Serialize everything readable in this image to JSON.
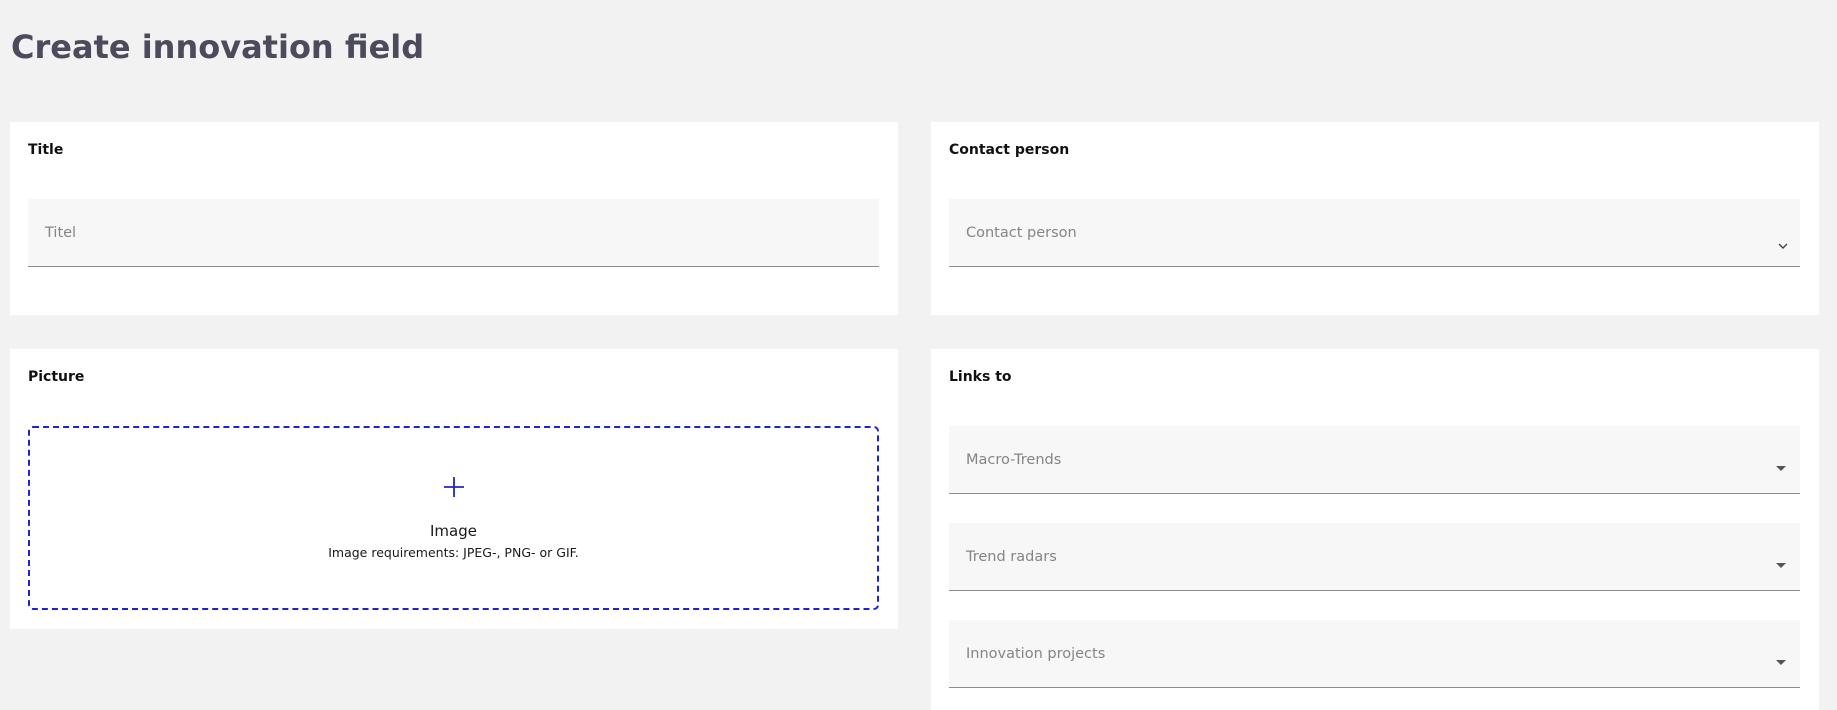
{
  "page": {
    "title": "Create innovation field"
  },
  "title_card": {
    "label": "Title",
    "input_placeholder": "Titel"
  },
  "contact_card": {
    "label": "Contact person",
    "select_placeholder": "Contact person",
    "icon": "chevron-down-icon"
  },
  "picture_card": {
    "label": "Picture",
    "dropzone": {
      "icon": "plus-icon",
      "title": "Image",
      "requirements": "Image requirements: JPEG-, PNG- or GIF."
    }
  },
  "links_card": {
    "label": "Links to",
    "selects": [
      {
        "placeholder": "Macro-Trends",
        "icon": "caret-down-icon"
      },
      {
        "placeholder": "Trend radars",
        "icon": "caret-down-icon"
      },
      {
        "placeholder": "Innovation projects",
        "icon": "caret-down-icon"
      }
    ]
  },
  "colors": {
    "background": "#f2f2f2",
    "card": "#ffffff",
    "title_text": "#4b4b5c",
    "accent_dashed": "#1d24cc",
    "field_bg": "#f7f7f7",
    "placeholder": "#858585"
  }
}
